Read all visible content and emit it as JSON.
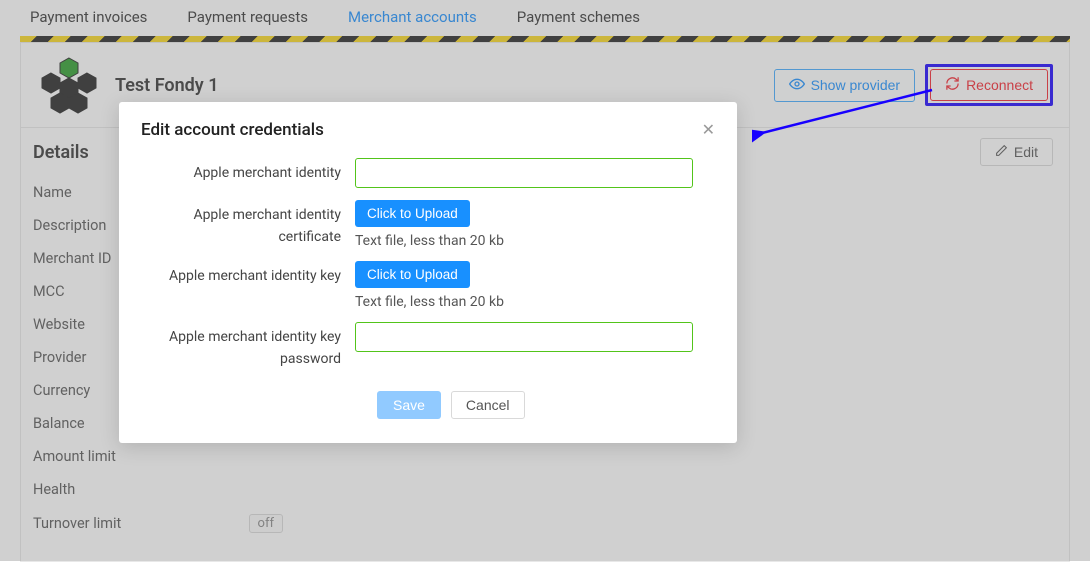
{
  "tabs": {
    "invoices": "Payment invoices",
    "requests": "Payment requests",
    "accounts": "Merchant accounts",
    "schemes": "Payment schemes"
  },
  "header": {
    "title": "Test Fondy 1",
    "show_provider": "Show provider",
    "reconnect": "Reconnect"
  },
  "details": {
    "title": "Details",
    "edit": "Edit",
    "items": [
      "Name",
      "Description",
      "Merchant ID",
      "MCC",
      "Website",
      "Provider",
      "Currency",
      "Balance",
      "Amount limit",
      "Health",
      "Turnover limit"
    ],
    "turnover_badge": "off"
  },
  "modal": {
    "title": "Edit account credentials",
    "fields": {
      "identity": {
        "label": "Apple merchant identity"
      },
      "cert": {
        "label": "Apple merchant identity certificate",
        "upload": "Click to Upload",
        "hint": "Text file, less than 20 kb"
      },
      "key": {
        "label": "Apple merchant identity key",
        "upload": "Click to Upload",
        "hint": "Text file, less than 20 kb"
      },
      "keypass": {
        "label": "Apple merchant identity key password"
      }
    },
    "save": "Save",
    "cancel": "Cancel"
  }
}
